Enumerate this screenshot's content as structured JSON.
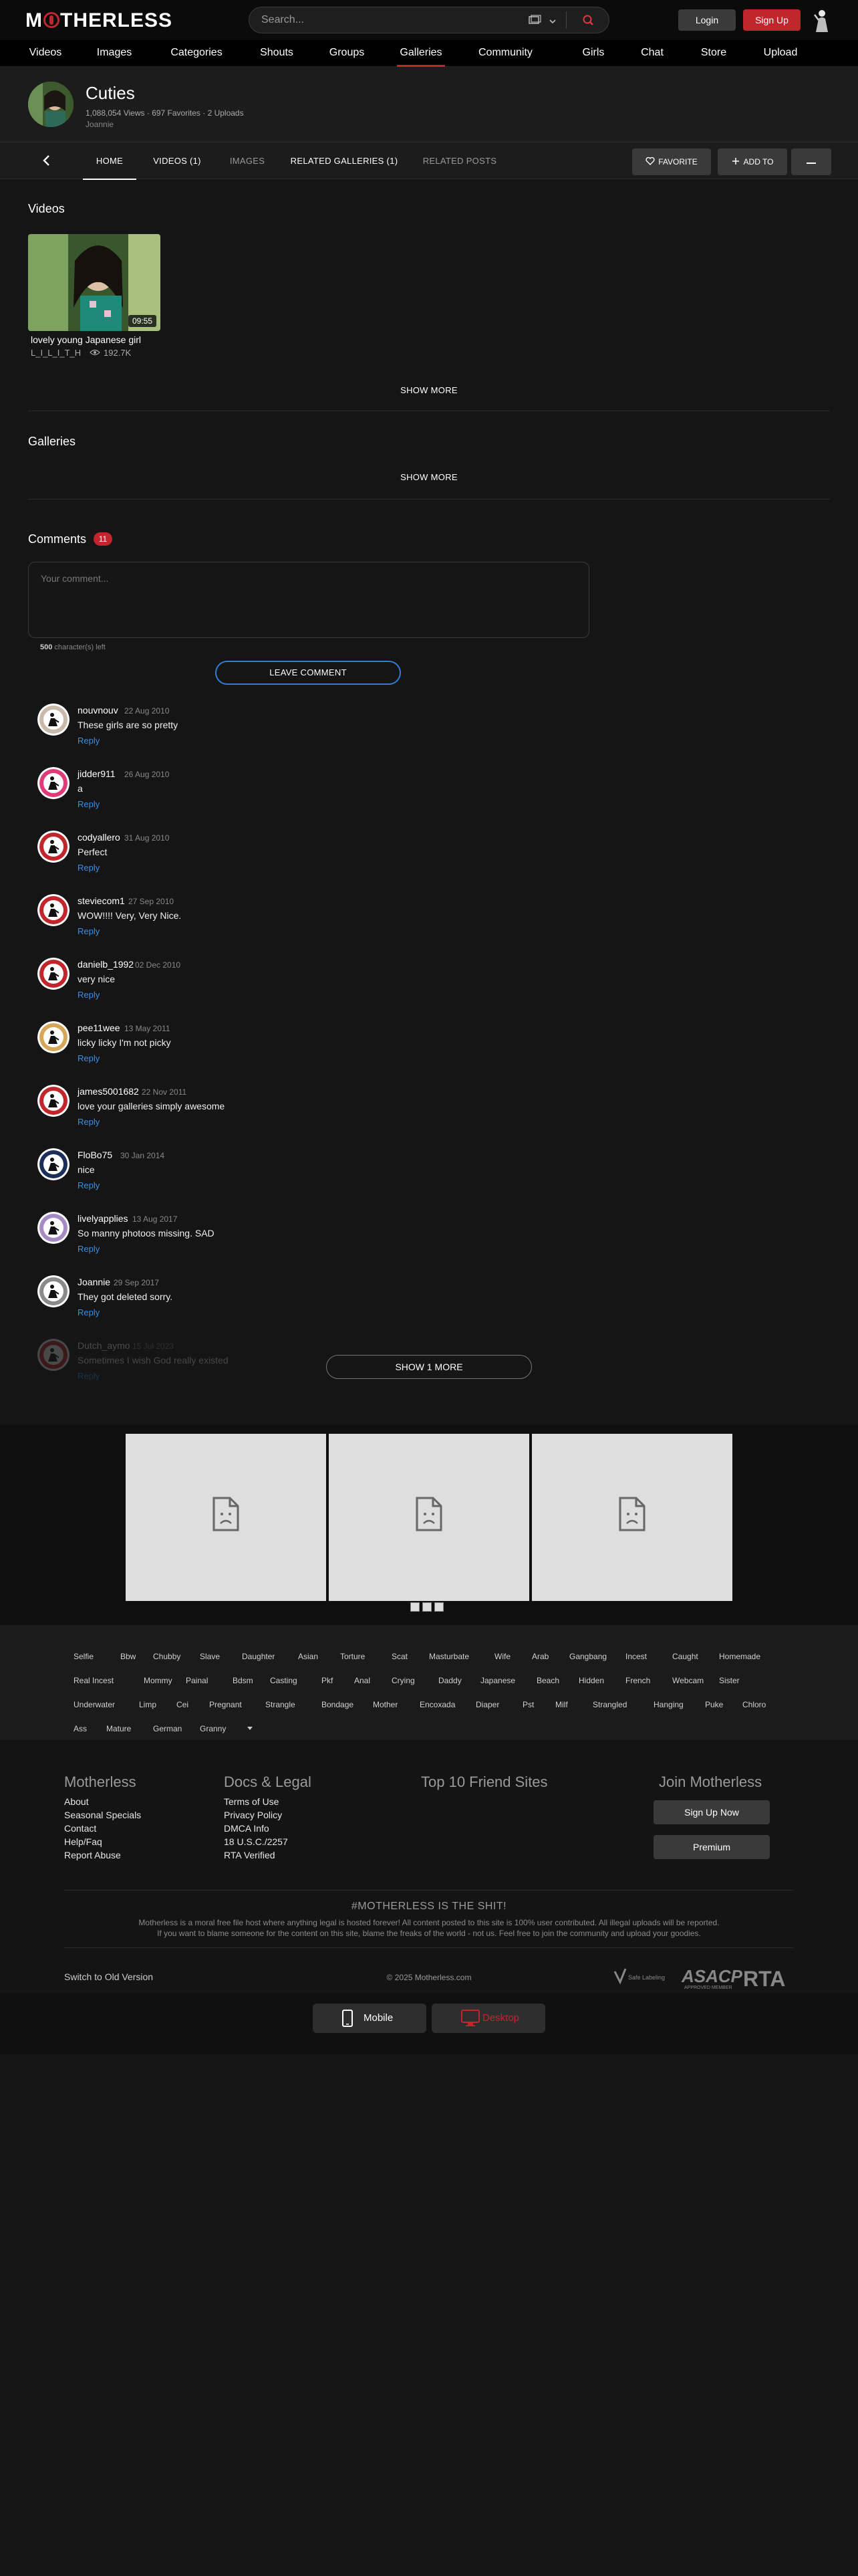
{
  "header": {
    "logo": "MOTHERLESS",
    "search_placeholder": "Search...",
    "login": "Login",
    "signup": "Sign Up"
  },
  "nav": [
    "Videos",
    "Images",
    "Categories",
    "Shouts",
    "Groups",
    "Galleries",
    "Community",
    "Girls",
    "Chat",
    "Store",
    "Upload"
  ],
  "gallery": {
    "title": "Cuties",
    "views": "1,088,054 Views",
    "favorites": "697 Favorites",
    "uploads": "2 Uploads",
    "owner": "Joannie"
  },
  "tabs": [
    "HOME",
    "VIDEOS (1)",
    "IMAGES",
    "RELATED GALLERIES (1)",
    "RELATED POSTS"
  ],
  "actions": {
    "favorite": "FAVORITE",
    "add_to": "ADD TO"
  },
  "videos": {
    "heading": "Videos",
    "items": [
      {
        "title": "lovely young Japanese girl",
        "user": "L_I_L_I_T_H",
        "views": "192.7K",
        "duration": "09:55"
      }
    ],
    "show_more": "SHOW MORE"
  },
  "galleries": {
    "heading": "Galleries",
    "show_more": "SHOW MORE"
  },
  "comments": {
    "heading": "Comments",
    "count": "11",
    "placeholder": "Your comment...",
    "chars_left_num": "500",
    "chars_left_text": "character(s) left",
    "leave": "LEAVE COMMENT",
    "reply": "Reply",
    "items": [
      {
        "user": "nouvnouv",
        "date": "22 Aug 2010",
        "text": "These girls are so pretty",
        "avatar_color": "#c9b9a8"
      },
      {
        "user": "jidder911",
        "date": "26 Aug 2010",
        "text": "a",
        "avatar_color": "#e23a78"
      },
      {
        "user": "codyallero",
        "date": "31 Aug 2010",
        "text": "Perfect",
        "avatar_color": "#c0262b"
      },
      {
        "user": "steviecom1",
        "date": "27 Sep 2010",
        "text": "WOW!!!! Very, Very Nice.",
        "avatar_color": "#c0262b"
      },
      {
        "user": "danielb_1992",
        "date": "02 Dec 2010",
        "text": "very nice",
        "avatar_color": "#c0262b"
      },
      {
        "user": "pee11wee",
        "date": "13 May 2011",
        "text": "licky licky I'm not picky",
        "avatar_color": "#d6a756"
      },
      {
        "user": "james5001682",
        "date": "22 Nov 2011",
        "text": "love your galleries simply awesome",
        "avatar_color": "#c0262b"
      },
      {
        "user": "FloBo75",
        "date": "30 Jan 2014",
        "text": "nice",
        "avatar_color": "#1c2f5a"
      },
      {
        "user": "livelyapplies",
        "date": "13 Aug 2017",
        "text": "So manny photoos missing. SAD",
        "avatar_color": "#a58bc2"
      },
      {
        "user": "Joannie",
        "date": "29 Sep 2017",
        "text": "They got deleted sorry.",
        "avatar_color": "#8a8a8a"
      },
      {
        "user": "Dutch_aymo",
        "date": "15 Jul 2023",
        "text": "Sometimes I wish God really existed",
        "avatar_color": "#c0262b"
      }
    ],
    "show_one_more": "SHOW 1 MORE"
  },
  "tags": [
    [
      "Selfie",
      "Bbw",
      "Chubby",
      "Slave",
      "Daughter",
      "Asian",
      "Torture",
      "Scat",
      "Masturbate",
      "Wife",
      "Arab",
      "Gangbang",
      "Incest",
      "Caught",
      "Homemade"
    ],
    [
      "Real Incest",
      "Mommy",
      "Painal",
      "Bdsm",
      "Casting",
      "Pkf",
      "Anal",
      "Crying",
      "Daddy",
      "Japanese",
      "Beach",
      "Hidden",
      "French",
      "Webcam",
      "Sister"
    ],
    [
      "Underwater",
      "Limp",
      "Cei",
      "Pregnant",
      "Strangle",
      "Bondage",
      "Mother",
      "Encoxada",
      "Diaper",
      "Pst",
      "Milf",
      "Strangled",
      "Hanging",
      "Puke",
      "Chloro"
    ],
    [
      "Ass",
      "Mature",
      "German",
      "Granny"
    ]
  ],
  "footer": {
    "col1": {
      "title": "Motherless",
      "links": [
        "About",
        "Seasonal Specials",
        "Contact",
        "Help/Faq",
        "Report Abuse"
      ]
    },
    "col2": {
      "title": "Docs & Legal",
      "links": [
        "Terms of Use",
        "Privacy Policy",
        "DMCA Info",
        "18 U.S.C./2257",
        "RTA Verified"
      ]
    },
    "col3": {
      "title": "Top 10 Friend Sites"
    },
    "col4": {
      "title": "Join Motherless",
      "signup": "Sign Up Now",
      "premium": "Premium"
    },
    "slogan": "#MOTHERLESS IS THE SHIT!",
    "desc1": "Motherless is a moral free file host where anything legal is hosted forever! All content posted to this site is 100% user contributed. All illegal uploads will be reported.",
    "desc2": "If you want to blame someone for the content on this site, blame the freaks of the world - not us. Feel free to join the community and upload your goodies.",
    "switch": "Switch to Old Version",
    "copyright": "© 2025 Motherless.com",
    "logo_safe": "Safe Labeling",
    "logo_asacp": "ASACP",
    "logo_asacp_sub": "APPROVED MEMBER",
    "logo_rta": "RTA",
    "mobile": "Mobile",
    "desktop": "Desktop"
  },
  "colors": {
    "accent": "#c0262b",
    "link": "#3b8fe0",
    "bg": "#151515"
  }
}
